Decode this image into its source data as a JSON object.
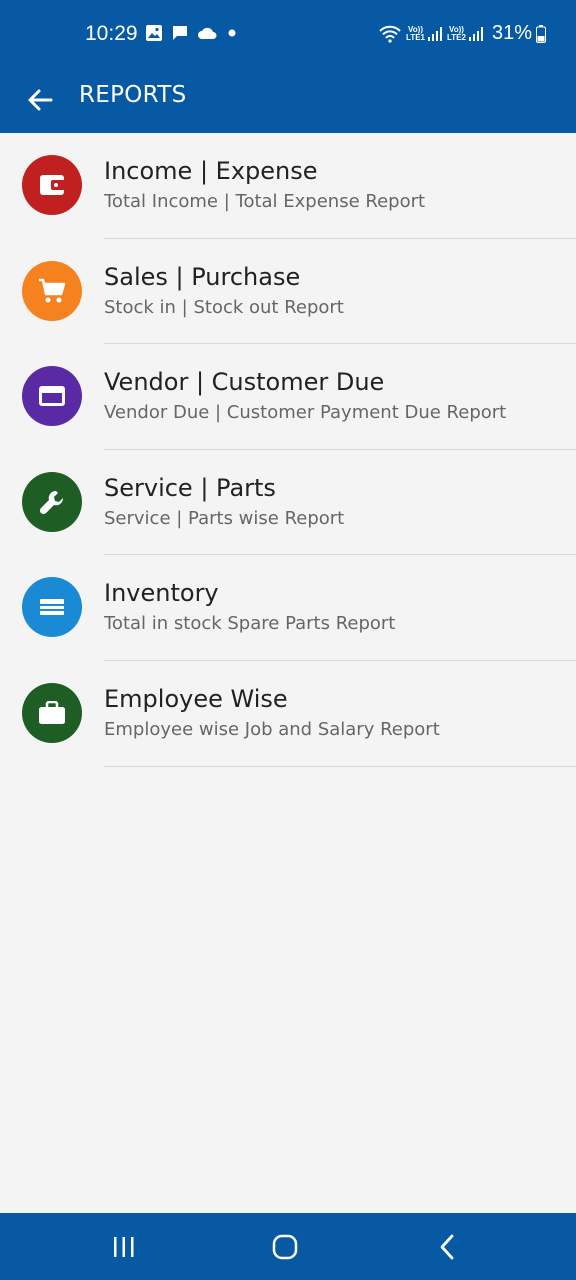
{
  "status_bar": {
    "time": "10:29",
    "battery": "31%",
    "sim1_label": "LTE1",
    "sim2_label": "LTE2",
    "volte": "Vo))"
  },
  "app_bar": {
    "title": "REPORTS"
  },
  "reports": [
    {
      "title": "Income | Expense",
      "subtitle": "Total Income | Total Expense Report",
      "icon": "wallet-icon",
      "color": "#c0201f"
    },
    {
      "title": "Sales | Purchase",
      "subtitle": "Stock in | Stock out Report",
      "icon": "cart-icon",
      "color": "#f5821f"
    },
    {
      "title": "Vendor | Customer Due",
      "subtitle": "Vendor Due | Customer Payment Due Report",
      "icon": "credit-card-icon",
      "color": "#5a2aa5"
    },
    {
      "title": "Service | Parts",
      "subtitle": "Service | Parts wise Report",
      "icon": "wrench-icon",
      "color": "#1e5d23"
    },
    {
      "title": "Inventory",
      "subtitle": "Total in stock Spare Parts Report",
      "icon": "inventory-icon",
      "color": "#1b8ad5"
    },
    {
      "title": "Employee Wise",
      "subtitle": "Employee wise Job and Salary Report",
      "icon": "briefcase-icon",
      "color": "#1e5d23"
    }
  ]
}
